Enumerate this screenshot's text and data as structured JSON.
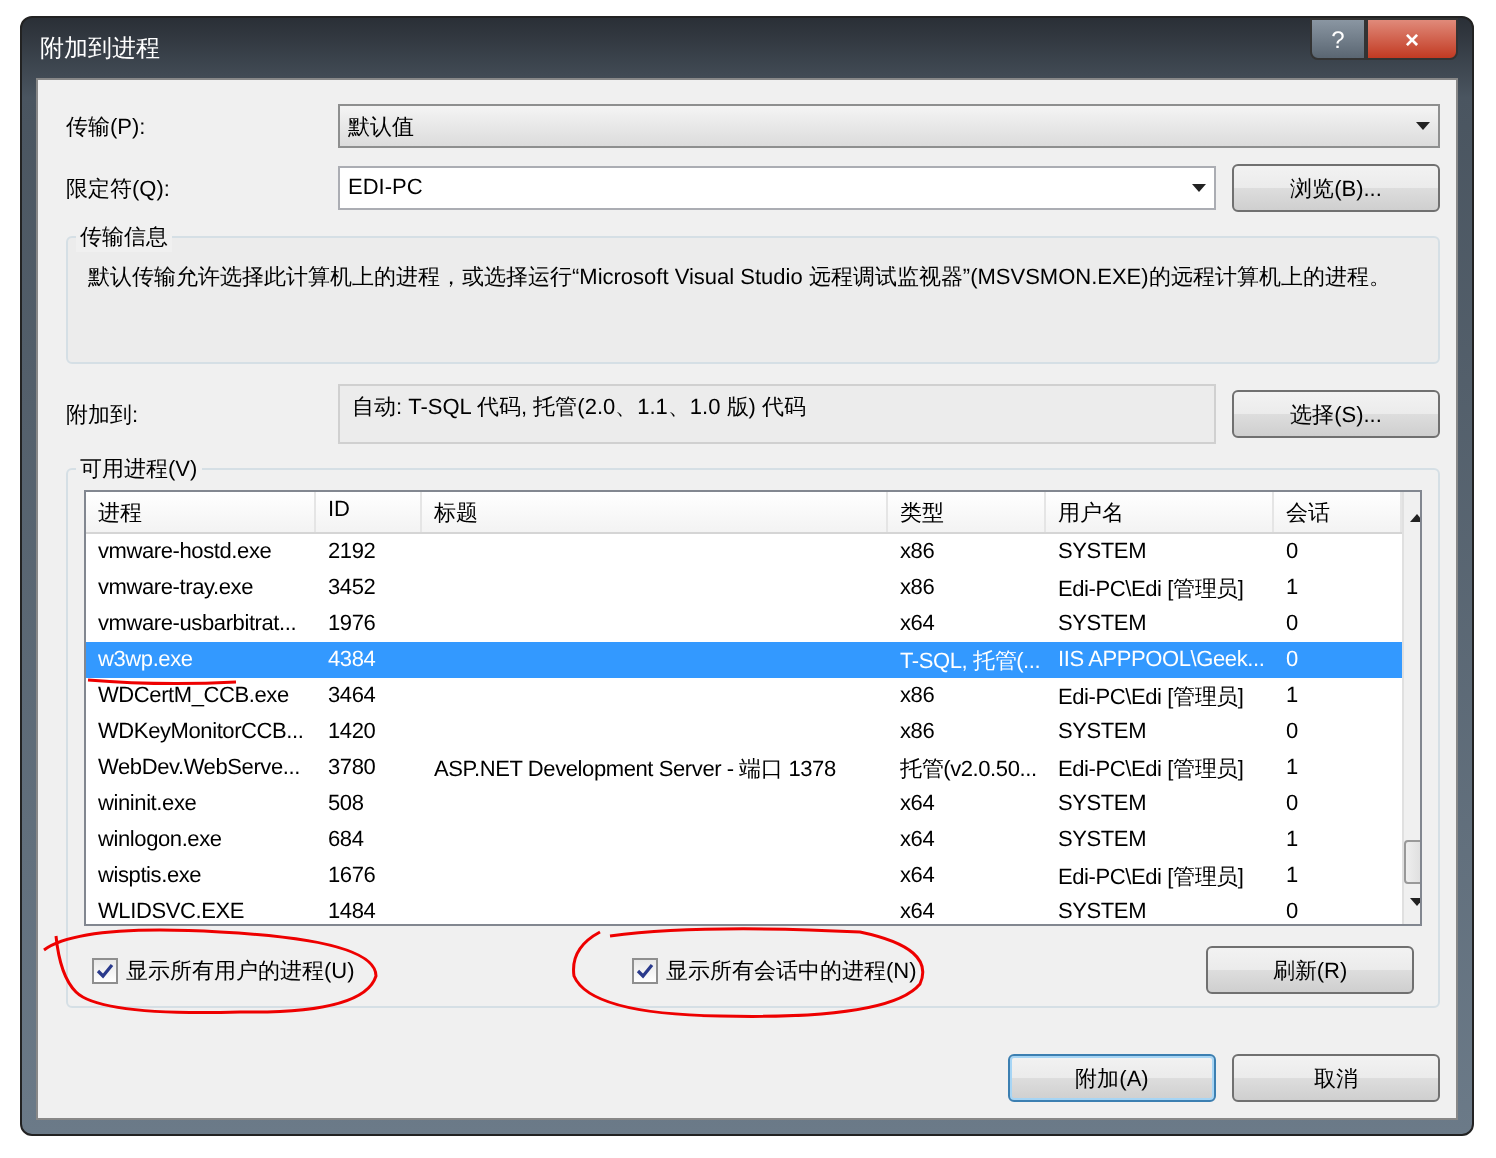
{
  "window": {
    "title": "附加到进程",
    "help_button": "?",
    "close_button": "×"
  },
  "transport": {
    "label": "传输(P):",
    "value": "默认值"
  },
  "qualifier": {
    "label": "限定符(Q):",
    "value": "EDI-PC",
    "browse_button": "浏览(B)..."
  },
  "transport_info": {
    "title": "传输信息",
    "text": "默认传输允许选择此计算机上的进程，或选择运行“Microsoft Visual Studio 远程调试监视器”(MSVSMON.EXE)的远程计算机上的进程。"
  },
  "attach_to": {
    "label": "附加到:",
    "value": "自动: T-SQL 代码, 托管(2.0、1.1、1.0 版) 代码",
    "select_button": "选择(S)..."
  },
  "processes": {
    "title": "可用进程(V)",
    "columns": [
      "进程",
      "ID",
      "标题",
      "类型",
      "用户名",
      "会话"
    ],
    "rows": [
      {
        "cells": [
          "vmware-hostd.exe",
          "2192",
          "",
          "x86",
          "SYSTEM",
          "0"
        ],
        "selected": false
      },
      {
        "cells": [
          "vmware-tray.exe",
          "3452",
          "",
          "x86",
          "Edi-PC\\Edi [管理员]",
          "1"
        ],
        "selected": false
      },
      {
        "cells": [
          "vmware-usbarbitrat...",
          "1976",
          "",
          "x64",
          "SYSTEM",
          "0"
        ],
        "selected": false
      },
      {
        "cells": [
          "w3wp.exe",
          "4384",
          "",
          "T-SQL, 托管(...",
          "IIS APPPOOL\\Geek...",
          "0"
        ],
        "selected": true
      },
      {
        "cells": [
          "WDCertM_CCB.exe",
          "3464",
          "",
          "x86",
          "Edi-PC\\Edi [管理员]",
          "1"
        ],
        "selected": false
      },
      {
        "cells": [
          "WDKeyMonitorCCB...",
          "1420",
          "",
          "x86",
          "SYSTEM",
          "0"
        ],
        "selected": false
      },
      {
        "cells": [
          "WebDev.WebServe...",
          "3780",
          "ASP.NET Development Server - 端口 1378",
          "托管(v2.0.50...",
          "Edi-PC\\Edi [管理员]",
          "1"
        ],
        "selected": false
      },
      {
        "cells": [
          "wininit.exe",
          "508",
          "",
          "x64",
          "SYSTEM",
          "0"
        ],
        "selected": false
      },
      {
        "cells": [
          "winlogon.exe",
          "684",
          "",
          "x64",
          "SYSTEM",
          "1"
        ],
        "selected": false
      },
      {
        "cells": [
          "wisptis.exe",
          "1676",
          "",
          "x64",
          "Edi-PC\\Edi [管理员]",
          "1"
        ],
        "selected": false
      },
      {
        "cells": [
          "WLIDSVC.EXE",
          "1484",
          "",
          "x64",
          "SYSTEM",
          "0"
        ],
        "selected": false
      }
    ]
  },
  "options": [
    {
      "label": "显示所有用户的进程(U)",
      "checked": true
    },
    {
      "label": "显示所有会话中的进程(N)",
      "checked": true
    }
  ],
  "refresh_button": "刷新(R)",
  "buttons": [
    {
      "label": "附加(A)",
      "default": true
    },
    {
      "label": "取消",
      "default": false
    }
  ]
}
